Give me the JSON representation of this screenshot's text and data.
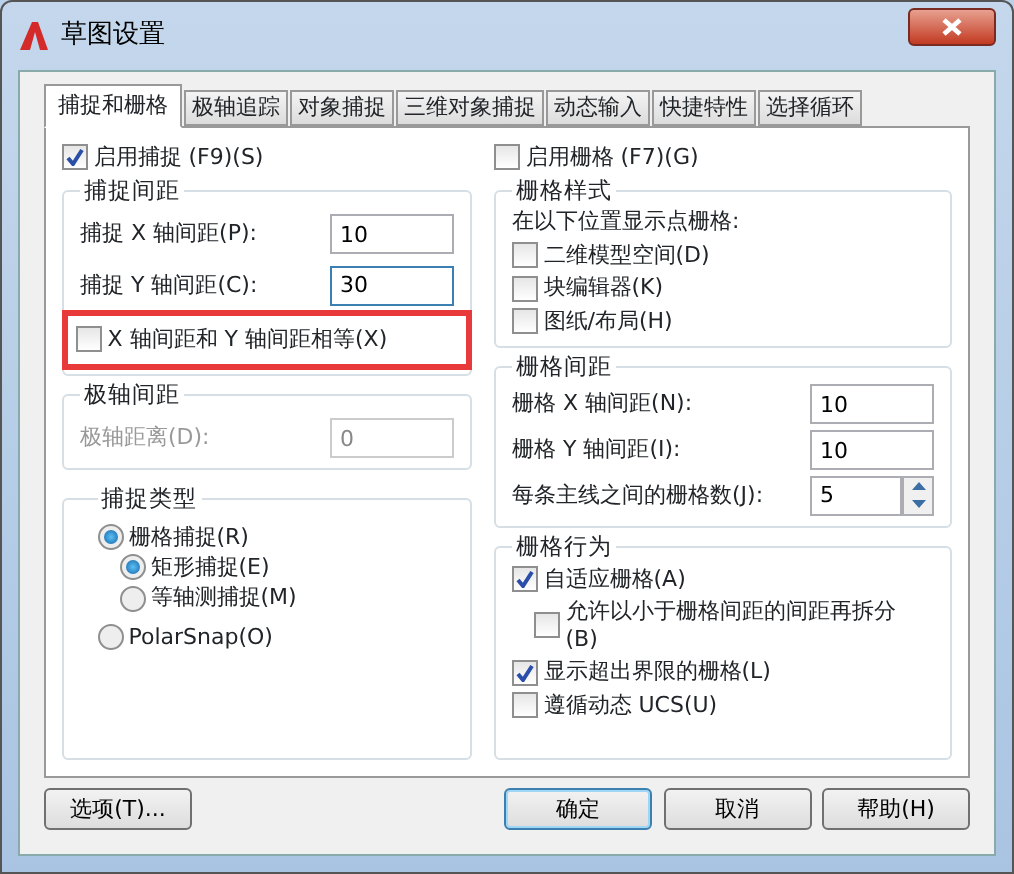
{
  "window": {
    "title": "草图设置"
  },
  "tabs": [
    {
      "label": "捕捉和栅格",
      "selected": true
    },
    {
      "label": "极轴追踪",
      "selected": false
    },
    {
      "label": "对象捕捉",
      "selected": false
    },
    {
      "label": "三维对象捕捉",
      "selected": false
    },
    {
      "label": "动态输入",
      "selected": false
    },
    {
      "label": "快捷特性",
      "selected": false
    },
    {
      "label": "选择循环",
      "selected": false
    }
  ],
  "snap": {
    "enable": {
      "label": "启用捕捉 (F9)(S)",
      "checked": true
    },
    "spacing": {
      "title": "捕捉间距",
      "fields": [
        {
          "label": "捕捉 X 轴间距(P):",
          "value": "10",
          "focused": false
        },
        {
          "label": "捕捉 Y 轴间距(C):",
          "value": "30",
          "focused": true
        }
      ],
      "equal": {
        "label": "X 轴间距和 Y 轴间距相等(X)",
        "checked": false,
        "highlighted": true
      }
    },
    "polar": {
      "title": "极轴间距",
      "field": {
        "label": "极轴距离(D):",
        "value": "0",
        "disabled": true
      }
    },
    "type": {
      "title": "捕捉类型",
      "options": [
        {
          "label": "栅格捕捉(R)",
          "selected": true,
          "children": [
            {
              "label": "矩形捕捉(E)",
              "selected": true
            },
            {
              "label": "等轴测捕捉(M)",
              "selected": false
            }
          ]
        },
        {
          "label": "PolarSnap(O)",
          "selected": false
        }
      ]
    }
  },
  "grid": {
    "enable": {
      "label": "启用栅格 (F7)(G)",
      "checked": false
    },
    "style": {
      "title": "栅格样式",
      "caption": "在以下位置显示点栅格:",
      "options": [
        {
          "label": "二维模型空间(D)",
          "checked": false
        },
        {
          "label": "块编辑器(K)",
          "checked": false
        },
        {
          "label": "图纸/布局(H)",
          "checked": false
        }
      ]
    },
    "spacing": {
      "title": "栅格间距",
      "fields": [
        {
          "label": "栅格 X 轴间距(N):",
          "value": "10",
          "kind": "text"
        },
        {
          "label": "栅格 Y 轴间距(I):",
          "value": "10",
          "kind": "text"
        },
        {
          "label": "每条主线之间的栅格数(J):",
          "value": "5",
          "kind": "spinner"
        }
      ]
    },
    "behavior": {
      "title": "栅格行为",
      "options": [
        {
          "label": "自适应栅格(A)",
          "checked": true,
          "children": [
            {
              "label": "允许以小于栅格间距的间距再拆分(B)",
              "checked": false
            }
          ]
        },
        {
          "label": "显示超出界限的栅格(L)",
          "checked": true
        },
        {
          "label": "遵循动态 UCS(U)",
          "checked": false
        }
      ]
    }
  },
  "buttons": [
    {
      "label": "选项(T)...",
      "default": false
    },
    {
      "label": "确定",
      "default": true
    },
    {
      "label": "取消",
      "default": false
    },
    {
      "label": "帮助(H)",
      "default": false
    }
  ]
}
